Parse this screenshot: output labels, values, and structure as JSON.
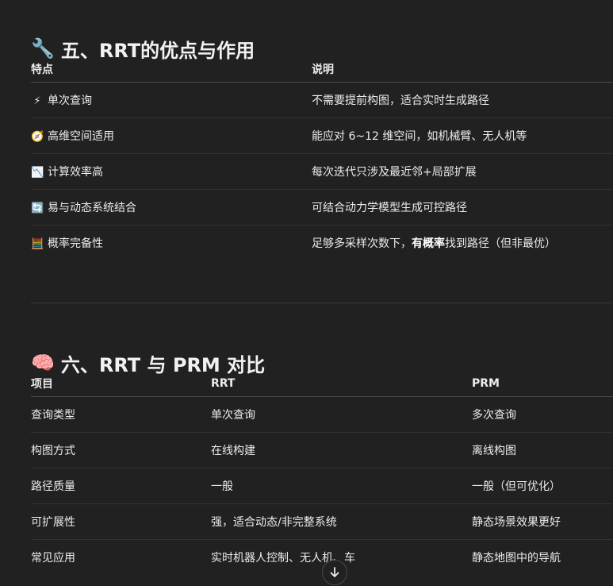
{
  "section5": {
    "emoji": "🔧",
    "title": "五、RRT的优点与作用",
    "headers": [
      "特点",
      "说明"
    ],
    "rows": [
      {
        "icon": "⚡",
        "icon_name": "lightning-icon",
        "feature": "单次查询",
        "desc": "不需要提前构图，适合实时生成路径"
      },
      {
        "icon": "🧭",
        "icon_name": "compass-icon",
        "feature": "高维空间适用",
        "desc": "能应对 6~12 维空间，如机械臂、无人机等"
      },
      {
        "icon": "📉",
        "icon_name": "chart-icon",
        "feature": "计算效率高",
        "desc": "每次迭代只涉及最近邻+局部扩展"
      },
      {
        "icon": "🔄",
        "icon_name": "cycle-icon",
        "feature": "易与动态系统结合",
        "desc": "可结合动力学模型生成可控路径"
      },
      {
        "icon": "🧮",
        "icon_name": "abacus-icon",
        "feature": "概率完备性",
        "desc_pre": "足够多采样次数下，",
        "desc_bold": "有概率",
        "desc_post": "找到路径（但非最优）"
      }
    ]
  },
  "section6": {
    "emoji": "🧠",
    "title": "六、RRT 与 PRM 对比",
    "headers": [
      "项目",
      "RRT",
      "PRM"
    ],
    "rows": [
      [
        "查询类型",
        "单次查询",
        "多次查询"
      ],
      [
        "构图方式",
        "在线构建",
        "离线构图"
      ],
      [
        "路径质量",
        "一般",
        "一般（但可优化）"
      ],
      [
        "可扩展性",
        "强，适合动态/非完整系统",
        "静态场景效果更好"
      ],
      [
        "常见应用",
        "实时机器人控制、无人机、车",
        "静态地图中的导航"
      ]
    ]
  },
  "scroll_button": {
    "icon": "arrow-down-icon"
  }
}
